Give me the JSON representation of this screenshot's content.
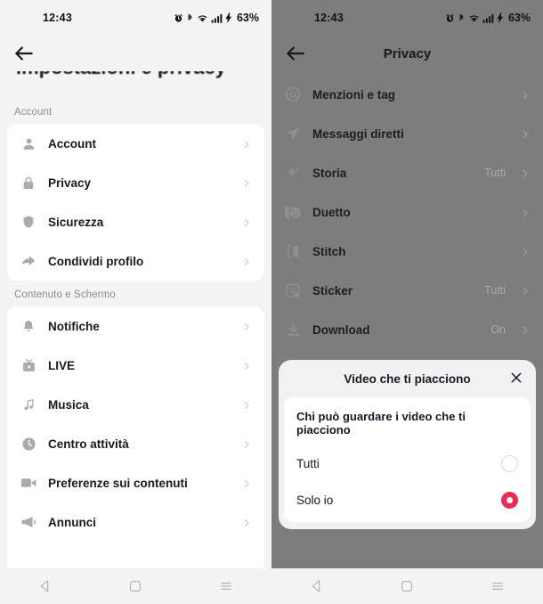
{
  "status_bar": {
    "time": "12:43",
    "battery": "63%",
    "icons": [
      "alarm-icon",
      "bluetooth-icon",
      "wifi-icon",
      "signal-icon",
      "charging-bolt-icon"
    ]
  },
  "left_screen": {
    "back_icon": "back-arrow-icon",
    "obscured_title": "Impostazioni e privacy",
    "sections": [
      {
        "label": "Account",
        "items": [
          {
            "icon": "person-icon",
            "label": "Account",
            "value": ""
          },
          {
            "icon": "lock-icon",
            "label": "Privacy",
            "value": ""
          },
          {
            "icon": "shield-icon",
            "label": "Sicurezza",
            "value": ""
          },
          {
            "icon": "share-icon",
            "label": "Condividi profilo",
            "value": ""
          }
        ]
      },
      {
        "label": "Contenuto e Schermo",
        "items": [
          {
            "icon": "bell-icon",
            "label": "Notifiche",
            "value": ""
          },
          {
            "icon": "live-tv-icon",
            "label": "LIVE",
            "value": ""
          },
          {
            "icon": "music-icon",
            "label": "Musica",
            "value": ""
          },
          {
            "icon": "clock-icon",
            "label": "Centro attività",
            "value": ""
          },
          {
            "icon": "video-icon",
            "label": "Preferenze sui contenuti",
            "value": ""
          },
          {
            "icon": "megaphone-icon",
            "label": "Annunci",
            "value": ""
          }
        ]
      }
    ]
  },
  "right_screen": {
    "back_icon": "back-arrow-icon",
    "title": "Privacy",
    "items": [
      {
        "icon": "at-icon",
        "label": "Menzioni e tag",
        "value": ""
      },
      {
        "icon": "paperplane-icon",
        "label": "Messaggi diretti",
        "value": ""
      },
      {
        "icon": "sparkle-icon",
        "label": "Storia",
        "value": "Tutti"
      },
      {
        "icon": "duet-icon",
        "label": "Duetto",
        "value": ""
      },
      {
        "icon": "stitch-icon",
        "label": "Stitch",
        "value": ""
      },
      {
        "icon": "sticker-icon",
        "label": "Sticker",
        "value": "Tutti"
      },
      {
        "icon": "download-icon",
        "label": "Download",
        "value": "On"
      }
    ],
    "modal": {
      "title": "Video che ti piacciono",
      "close_icon": "close-icon",
      "question": "Chi può guardare i video che ti piacciono",
      "options": [
        {
          "label": "Tutti",
          "selected": false
        },
        {
          "label": "Solo io",
          "selected": true
        }
      ],
      "accent_color": "#ED2A55"
    }
  },
  "system_nav": {
    "back": "nav-back-icon",
    "home": "nav-home-icon",
    "recents": "nav-recents-icon"
  }
}
